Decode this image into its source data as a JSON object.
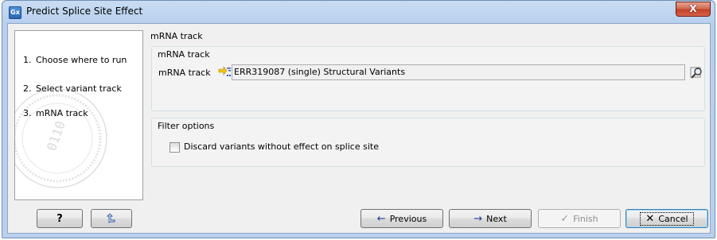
{
  "window": {
    "title": "Predict Splice Site Effect",
    "app_icon_text": "Gx",
    "close_glyph": "X"
  },
  "steps": [
    {
      "num": "1.",
      "label": "Choose where to run"
    },
    {
      "num": "2.",
      "label": "Select variant track"
    },
    {
      "num": "3.",
      "label": "mRNA track"
    }
  ],
  "page": {
    "title": "mRNA track",
    "mrna_group": {
      "title": "mRNA track",
      "field_label": "mRNA track",
      "field_value": "ERR319087 (single) Structural Variants",
      "track_icon": "structural-variant-track-icon",
      "browse_icon": "browse-icon"
    },
    "filter_group": {
      "title": "Filter options",
      "checkbox_label": "Discard variants without effect on splice site",
      "checked": false
    }
  },
  "buttons": {
    "help": "?",
    "reset_icon": "reset-icon",
    "previous": "Previous",
    "next": "Next",
    "finish": "Finish",
    "cancel": "Cancel"
  },
  "colors": {
    "title_bar": "#b9d0ec",
    "close_button": "#c24128",
    "dialog_bg": "#f0f0f0",
    "arrow_blue": "#1f3f9a"
  }
}
